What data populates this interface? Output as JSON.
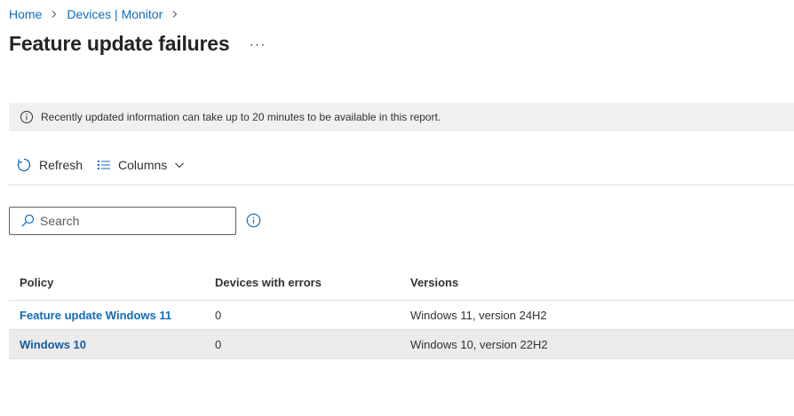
{
  "breadcrumb": {
    "items": [
      "Home",
      "Devices | Monitor"
    ]
  },
  "page": {
    "title": "Feature update failures",
    "more_label": "···"
  },
  "banner": {
    "text": "Recently updated information can take up to 20 minutes to be available in this report."
  },
  "toolbar": {
    "refresh_label": "Refresh",
    "columns_label": "Columns"
  },
  "search": {
    "placeholder": "Search",
    "value": ""
  },
  "table": {
    "columns": [
      "Policy",
      "Devices with errors",
      "Versions"
    ],
    "rows": [
      {
        "policy": "Feature update Windows 11",
        "devices_with_errors": "0",
        "versions": "Windows 11, version 24H2",
        "selected": false
      },
      {
        "policy": "Windows 10",
        "devices_with_errors": "0",
        "versions": "Windows 10, version 22H2",
        "selected": true
      }
    ]
  },
  "colors": {
    "accent": "#0f6cbd",
    "banner_bg": "#f0f0f0",
    "selected_row_bg": "#edebe9"
  }
}
